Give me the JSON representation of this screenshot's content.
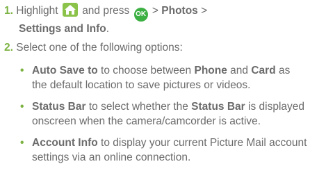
{
  "step1": {
    "number": "1.",
    "pre_icon": "Highlight",
    "home_icon": "home-icon",
    "mid": "and press",
    "ok_label": "OK",
    "sep1": ">",
    "photos": "Photos",
    "sep2": ">",
    "settings": "Settings and Info",
    "end": "."
  },
  "step2": {
    "number": "2.",
    "text": "Select one of the following options:"
  },
  "bullets": [
    {
      "bullet": "•",
      "term": "Auto Save to",
      "t1": " to choose between ",
      "b1": "Phone",
      "t2": " and ",
      "b2": "Card",
      "t3": " as the default location to save pictures or videos."
    },
    {
      "bullet": "•",
      "term": "Status Bar",
      "t1": " to select whether the ",
      "b1": "Status Bar",
      "t2": " is displayed onscreen when the camera/camcorder is active."
    },
    {
      "bullet": "•",
      "term": "Account Info",
      "t1": " to display your current Picture Mail account settings via an online connection."
    }
  ],
  "colors": {
    "accent": "#7cb342",
    "text": "#6b6b6b",
    "ok_button": "#3cb043"
  }
}
